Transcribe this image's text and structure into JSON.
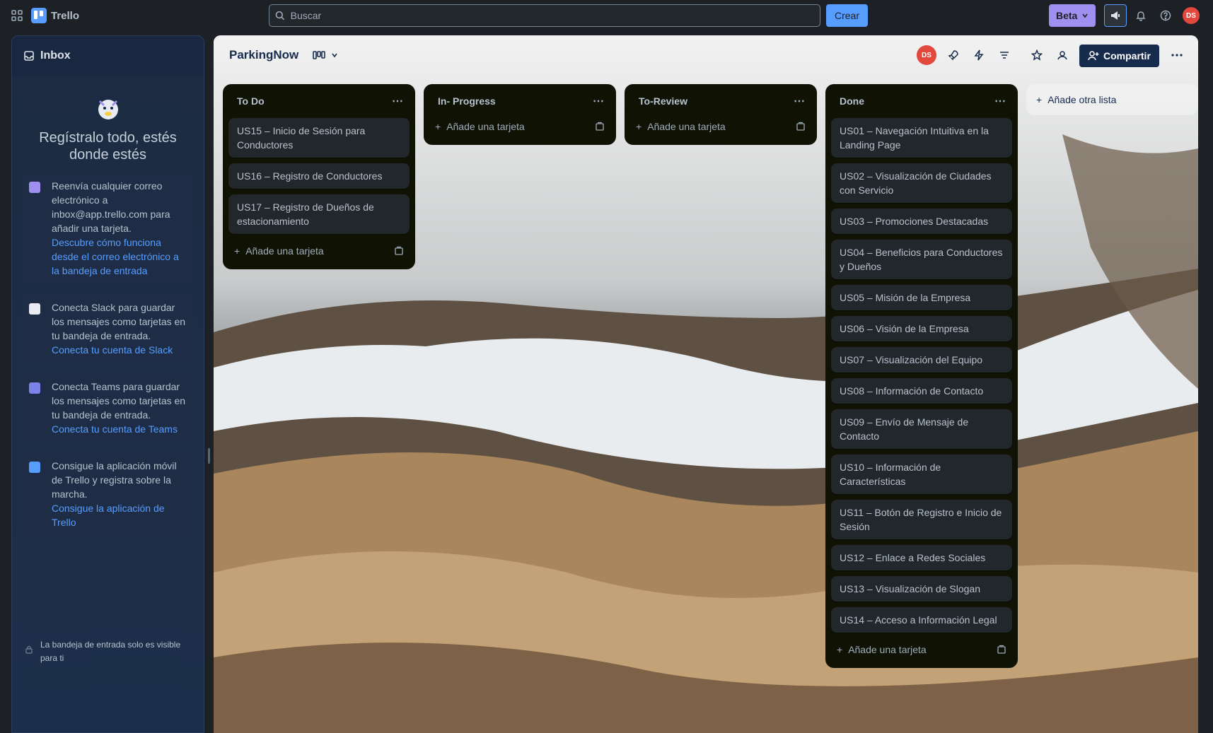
{
  "topbar": {
    "app_name": "Trello",
    "search_placeholder": "Buscar",
    "create_label": "Crear",
    "beta_label": "Beta",
    "avatar_initials": "DS"
  },
  "inbox": {
    "title": "Inbox",
    "headline": "Regístralo todo, estés donde estés",
    "cards": [
      {
        "text": "Reenvía cualquier correo electrónico a inbox@app.trello.com para añadir una tarjeta.",
        "link": "Descubre cómo funciona desde el correo electrónico a la bandeja de entrada"
      },
      {
        "text": "Conecta Slack para guardar los mensajes como tarjetas en tu bandeja de entrada.",
        "link": "Conecta tu cuenta de Slack"
      },
      {
        "text": "Conecta Teams para guardar los mensajes como tarjetas en tu bandeja de entrada.",
        "link": "Conecta tu cuenta de Teams"
      },
      {
        "text": "Consigue la aplicación móvil de Trello y registra sobre la marcha.",
        "link": "Consigue la aplicación de Trello"
      }
    ],
    "footer": "La bandeja de entrada solo es visible para ti"
  },
  "board": {
    "title": "ParkingNow",
    "share_label": "Compartir",
    "avatar_initials": "DS",
    "add_list_label": "Añade otra lista",
    "add_card_label": "Añade una tarjeta",
    "lists": [
      {
        "name": "To Do",
        "cards": [
          "US15 – Inicio de Sesión para Conductores",
          "US16 – Registro de Conductores",
          "US17 – Registro de Dueños de estacionamiento"
        ]
      },
      {
        "name": "In- Progress",
        "cards": []
      },
      {
        "name": "To-Review",
        "cards": []
      },
      {
        "name": "Done",
        "cards": [
          "US01 – Navegación Intuitiva en la Landing Page",
          "US02 – Visualización de Ciudades con Servicio",
          "US03 – Promociones Destacadas",
          "US04 – Beneficios para Conductores y Dueños",
          "US05 – Misión de la Empresa",
          "US06 – Visión de la Empresa",
          "US07 – Visualización del Equipo",
          "US08 – Información de Contacto",
          "US09 – Envío de Mensaje de Contacto",
          "US10 – Información de Características",
          "US11 – Botón de Registro e Inicio de Sesión",
          "US12 – Enlace a Redes Sociales",
          "US13 – Visualización de Slogan",
          "US14 – Acceso a Información Legal"
        ]
      }
    ]
  },
  "colors": {
    "accent": "#579dff",
    "beta": "#9f8fef",
    "avatar": "#e2483d",
    "list_bg": "#101204",
    "card_bg": "#22272b"
  }
}
